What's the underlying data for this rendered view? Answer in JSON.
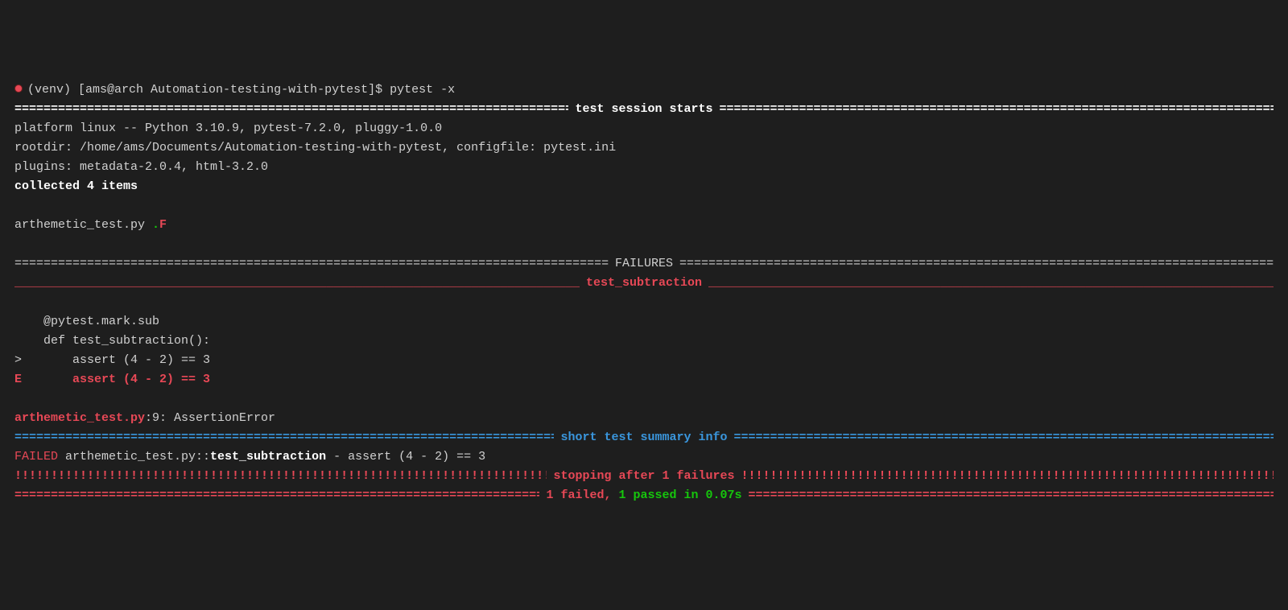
{
  "prompt": {
    "venv": "(venv)",
    "userhost": "[ams@arch Automation-testing-with-pytest]$",
    "command": "pytest -x"
  },
  "session_start_label": "test session starts",
  "platform_line": "platform linux -- Python 3.10.9, pytest-7.2.0, pluggy-1.0.0",
  "rootdir_line": "rootdir: /home/ams/Documents/Automation-testing-with-pytest, configfile: pytest.ini",
  "plugins_line": "plugins: metadata-2.0.4, html-3.2.0",
  "collected_line": "collected 4 items",
  "progress": {
    "file": "arthemetic_test.py ",
    "pass_dot": ".",
    "fail_F": "F"
  },
  "failures_label": "FAILURES",
  "test_name_label": "test_subtraction",
  "code": {
    "decorator": "    @pytest.mark.sub",
    "defline": "    def test_subtraction():",
    "assert_marker": ">       ",
    "assert_line": "assert (4 - 2) == 3",
    "error_marker": "E       ",
    "error_line": "assert (4 - 2) == 3"
  },
  "file_loc": {
    "file": "arthemetic_test.py",
    "suffix": ":9: AssertionError"
  },
  "summary_label": "short test summary info",
  "failed_line": {
    "prefix": "FAILED",
    "path": " arthemetic_test.py::",
    "test": "test_subtraction",
    "rest": " - assert (4 - 2) == 3"
  },
  "stopping_label": "stopping after 1 failures",
  "final": {
    "failed": "1 failed",
    "sep": ", ",
    "passed": "1 passed",
    "time": " in 0.07s"
  },
  "fills": {
    "eq": "====================================================================================================================================================================================================================",
    "underscore": "____________________________________________________________________________________________________________________________________________________________________________________________________________________",
    "bang": "!!!!!!!!!!!!!!!!!!!!!!!!!!!!!!!!!!!!!!!!!!!!!!!!!!!!!!!!!!!!!!!!!!!!!!!!!!!!!!!!!!!!!!!!!!!!!!!!!!!!!!!!!!!!!!!!!!!!!!!!!!!!!!!!!!!!!!!!!!!!!!!!!!!!!!!!!!!!!!!!!!!!!!!!!!!!!!!!!!!!!!!!!!!!!!!!!!!!!!!!!!!!!!!!!!!!"
  }
}
